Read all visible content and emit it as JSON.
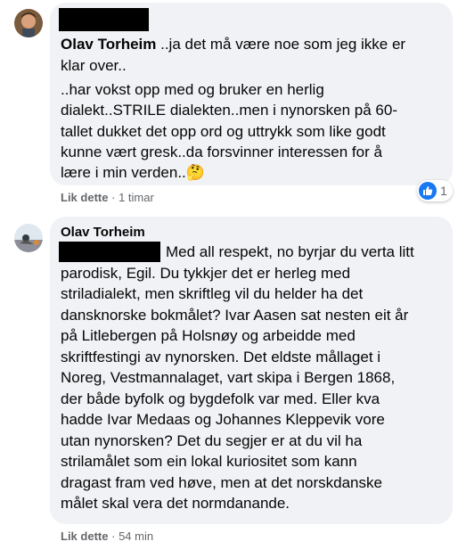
{
  "comments": [
    {
      "author": "Olav Torheim",
      "text_lines": [
        " ..ja det må være noe som jeg ikke er",
        "klar over..",
        "..har vokst opp med og bruker en herlig",
        "dialekt..STRILE dialekten..men i nynorsken på 60-",
        "tallet dukket det opp ord og uttrykk som like godt",
        "kunne vært gresk..da forsvinner interessen for å",
        "lære i min verden.."
      ],
      "emoji": "🤔",
      "like_label": "Lik dette",
      "separator": "·",
      "timestamp": "1 timar",
      "reaction_count": "1"
    },
    {
      "author": "Olav Torheim",
      "text_lines": [
        "Med all respekt, no byrjar du verta litt",
        "parodisk, Egil. Du tykkjer det er herleg med",
        "striladialekt, men skriftleg vil du helder ha det",
        "dansknorske bokmålet? Ivar Aasen sat nesten eit år",
        "på Litlebergen på Holsnøy og arbeidde med",
        "skriftfestingi av nynorsken. Det eldste mållaget i",
        "Noreg, Vestmannalaget, vart skipa i Bergen 1868,",
        "der både byfolk og bygdefolk var med. Eller kva",
        "hadde Ivar Medaas og Johannes Kleppevik vore",
        "utan nynorsken? Det du segjer er at du vil ha",
        "strilamålet som ein lokal kuriositet som kann",
        "dragast fram ved høve, men at det norskdanske",
        "målet skal vera det normdanande."
      ],
      "like_label": "Lik dette",
      "separator": "·",
      "timestamp": "54 min"
    }
  ]
}
